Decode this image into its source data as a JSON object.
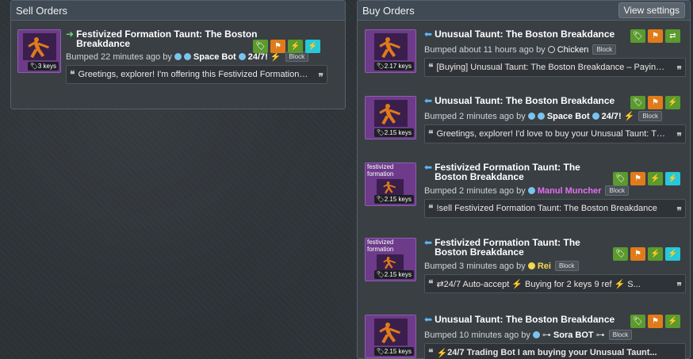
{
  "sell": {
    "header": "Sell Orders",
    "listings": [
      {
        "title": "Festivized Formation Taunt: The Boston Breakdance",
        "keys": "3 keys",
        "bumped_prefix": "Bumped 22 minutes ago by",
        "user": "Space Bot",
        "user_suffix": "24/7!",
        "block": "Block",
        "message": "Greetings, explorer! I'm offering this Festivized Formation Taunt: The Boston Breakdance..."
      }
    ]
  },
  "buy": {
    "header": "Buy Orders",
    "view_settings": "View settings",
    "listings": [
      {
        "title": "Unusual Taunt: The Boston Breakdance",
        "keys": "2.17 keys",
        "bumped_prefix": "Bumped about 11 hours ago by",
        "user": "Chicken",
        "block": "Block",
        "message": "[Buying] Unusual Taunt: The Boston Breakdance – Paying..."
      },
      {
        "title": "Unusual Taunt: The Boston Breakdance",
        "keys": "2.15 keys",
        "bumped_prefix": "Bumped 2 minutes ago by",
        "user": "Space Bot",
        "user_suffix": "24/7!",
        "block": "Block",
        "message": "Greetings, explorer! I'd love to buy your Unusual Taunt: The Boston Breakdance"
      },
      {
        "title": "Festivized Formation Taunt: The Boston Breakdance",
        "caption": "festivized formation",
        "keys": "2.15 keys",
        "bumped_prefix": "Bumped 2 minutes ago by",
        "user": "Manul Muncher",
        "block": "Block",
        "message": "!sell Festivized Formation Taunt: The Boston Breakdance"
      },
      {
        "title": "Festivized Formation Taunt: The Boston Breakdance",
        "caption": "festivized formation",
        "keys": "2.15 keys",
        "bumped_prefix": "Bumped 3 minutes ago by",
        "user": "Rei",
        "block": "Block",
        "message": "⇄24/7 Auto-accept ⚡ Buying for 2 keys 9 ref ⚡ S..."
      },
      {
        "title": "Unusual Taunt: The Boston Breakdance",
        "keys": "2.15 keys",
        "bumped_prefix": "Bumped 10 minutes ago by",
        "user": "Sora BOT",
        "block": "Block",
        "message": "24/7 Trading Bot I am buying your Unusual Taunt..."
      }
    ]
  },
  "colors": {
    "green": "#5b9a2e",
    "orange": "#e07b1a",
    "cyan": "#25c9d9",
    "thumb": "#6d3b8a"
  }
}
